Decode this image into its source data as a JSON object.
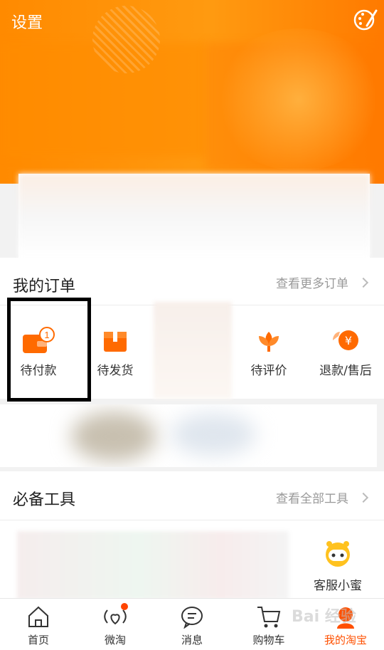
{
  "header": {
    "settings_label": "设置"
  },
  "orders": {
    "title": "我的订单",
    "more_label": "查看更多订单",
    "items": [
      {
        "label": "待付款",
        "icon": "wallet-icon",
        "badge": "1"
      },
      {
        "label": "待发货",
        "icon": "package-icon"
      },
      {
        "label": "待评价",
        "icon": "flower-icon"
      },
      {
        "label": "退款/售后",
        "icon": "refund-icon",
        "currency": "¥"
      }
    ]
  },
  "tools": {
    "title": "必备工具",
    "more_label": "查看全部工具",
    "service_label": "客服小蜜"
  },
  "tabbar": {
    "items": [
      {
        "label": "首页",
        "icon": "home-icon"
      },
      {
        "label": "微淘",
        "icon": "heart-signal-icon"
      },
      {
        "label": "消息",
        "icon": "message-icon"
      },
      {
        "label": "购物车",
        "icon": "cart-icon"
      },
      {
        "label": "我的淘宝",
        "icon": "profile-icon",
        "active": true
      }
    ]
  },
  "colors": {
    "accent": "#ff5000",
    "header": "#ff8a00",
    "highlight_border": "#000000"
  },
  "watermark": "Bai 经验"
}
